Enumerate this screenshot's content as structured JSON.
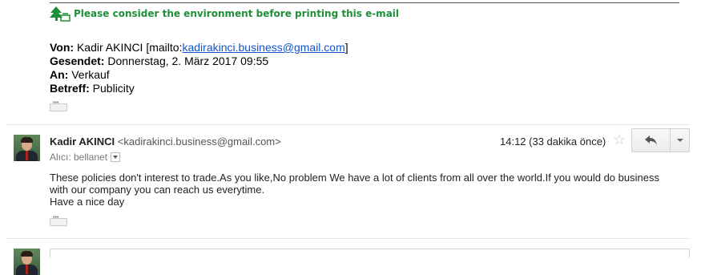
{
  "env_notice": {
    "text": "Please consider the environment before printing this e-mail",
    "icon": "tree-print-icon",
    "color": "#1d8f3a"
  },
  "quoted_header": {
    "von_label": "Von:",
    "von_name": "Kadir AKINCI [mailto:",
    "von_link": "kadirakinci.business@gmail.com",
    "von_close": "]",
    "gesendet_label": "Gesendet:",
    "gesendet_value": "Donnerstag, 2. März 2017 09:55",
    "an_label": "An:",
    "an_value": "Verkauf",
    "betreff_label": "Betreff:",
    "betreff_value": "Publicity"
  },
  "message": {
    "sender_name": "Kadir AKINCI",
    "sender_address": "<kadirakinci.business@gmail.com>",
    "to_text": "Alıcı: bellanet",
    "time": "14:12 (33 dakika önce)",
    "body_line1": "These policies don't interest to trade.As you like,No problem We have a lot of clients from all over the world.If you would do business",
    "body_line2": "with our company you can reach us everytime.",
    "body_line3": "Have a nice day"
  },
  "colors": {
    "link": "#1155cc",
    "env_green": "#1d8f3a"
  }
}
